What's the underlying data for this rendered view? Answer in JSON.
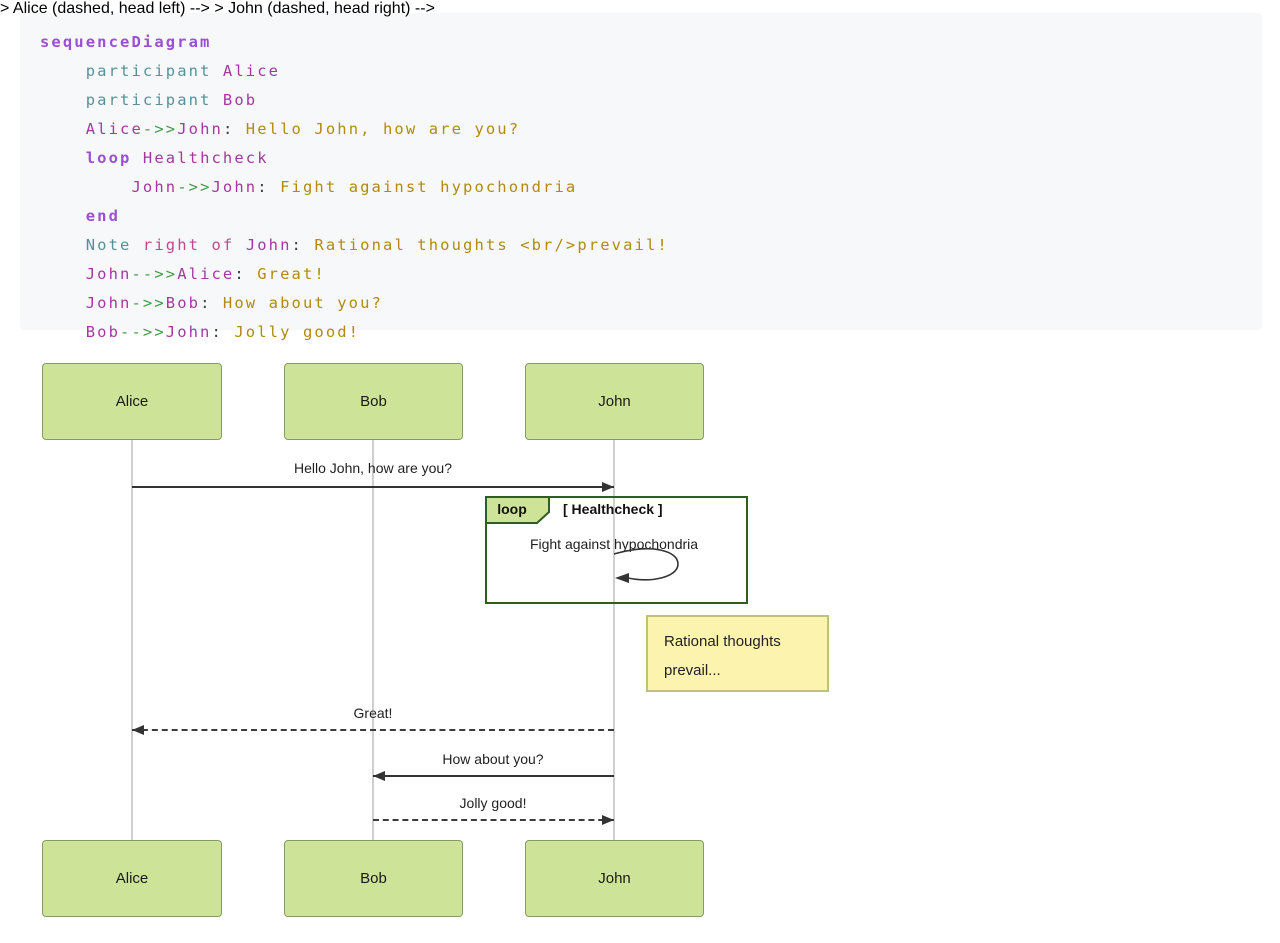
{
  "code": {
    "lines": [
      [
        {
          "t": "sequenceDiagram",
          "c": "kw"
        }
      ],
      [
        {
          "t": "    ",
          "c": "ws"
        },
        {
          "t": "participant",
          "c": "tl"
        },
        {
          "t": " ",
          "c": "ws"
        },
        {
          "t": "Alice",
          "c": "nm"
        }
      ],
      [
        {
          "t": "    ",
          "c": "ws"
        },
        {
          "t": "participant",
          "c": "tl"
        },
        {
          "t": " ",
          "c": "ws"
        },
        {
          "t": "Bob",
          "c": "nm"
        }
      ],
      [
        {
          "t": "    ",
          "c": "ws"
        },
        {
          "t": "Alice",
          "c": "nm"
        },
        {
          "t": "->>",
          "c": "op"
        },
        {
          "t": "John",
          "c": "nm"
        },
        {
          "t": ":",
          "c": "pn"
        },
        {
          "t": " Hello John, how are you?",
          "c": "tx"
        }
      ],
      [
        {
          "t": "    ",
          "c": "ws"
        },
        {
          "t": "loop",
          "c": "kw"
        },
        {
          "t": " ",
          "c": "ws"
        },
        {
          "t": "Healthcheck",
          "c": "nm"
        }
      ],
      [
        {
          "t": "        ",
          "c": "ws"
        },
        {
          "t": "John",
          "c": "nm"
        },
        {
          "t": "->>",
          "c": "op"
        },
        {
          "t": "John",
          "c": "nm"
        },
        {
          "t": ":",
          "c": "pn"
        },
        {
          "t": " Fight against hypochondria",
          "c": "tx"
        }
      ],
      [
        {
          "t": "    ",
          "c": "ws"
        },
        {
          "t": "end",
          "c": "kw"
        }
      ],
      [
        {
          "t": "    ",
          "c": "ws"
        },
        {
          "t": "Note",
          "c": "tl"
        },
        {
          "t": " ",
          "c": "ws"
        },
        {
          "t": "right of",
          "c": "kw2"
        },
        {
          "t": " ",
          "c": "ws"
        },
        {
          "t": "John",
          "c": "nm"
        },
        {
          "t": ":",
          "c": "pn"
        },
        {
          "t": " Rational thoughts <br/>prevail!",
          "c": "tx"
        }
      ],
      [
        {
          "t": "    ",
          "c": "ws"
        },
        {
          "t": "John",
          "c": "nm"
        },
        {
          "t": "-->>",
          "c": "op"
        },
        {
          "t": "Alice",
          "c": "nm"
        },
        {
          "t": ":",
          "c": "pn"
        },
        {
          "t": " Great!",
          "c": "tx"
        }
      ],
      [
        {
          "t": "    ",
          "c": "ws"
        },
        {
          "t": "John",
          "c": "nm"
        },
        {
          "t": "->>",
          "c": "op"
        },
        {
          "t": "Bob",
          "c": "nm"
        },
        {
          "t": ":",
          "c": "pn"
        },
        {
          "t": " How about you?",
          "c": "tx"
        }
      ],
      [
        {
          "t": "    ",
          "c": "ws"
        },
        {
          "t": "Bob",
          "c": "nm"
        },
        {
          "t": "-->>",
          "c": "op"
        },
        {
          "t": "John",
          "c": "nm"
        },
        {
          "t": ":",
          "c": "pn"
        },
        {
          "t": " Jolly good!",
          "c": "tx"
        }
      ]
    ]
  },
  "diagram": {
    "actors": [
      {
        "name": "Alice"
      },
      {
        "name": "Bob"
      },
      {
        "name": "John"
      }
    ],
    "messages": [
      {
        "text": "Hello John, how are you?",
        "from": "Alice",
        "to": "John",
        "style": "solid"
      },
      {
        "text": "Great!",
        "from": "John",
        "to": "Alice",
        "style": "dashed"
      },
      {
        "text": "How about you?",
        "from": "John",
        "to": "Bob",
        "style": "solid"
      },
      {
        "text": "Jolly good!",
        "from": "Bob",
        "to": "John",
        "style": "dashed"
      }
    ],
    "loop": {
      "label": "loop",
      "title": "[ Healthcheck ]",
      "message": "Fight against hypochondria"
    },
    "note": {
      "line1": "Rational thoughts",
      "line2": "prevail..."
    }
  },
  "colors": {
    "code_background": "#f7f8f9",
    "keyword": "#9a4fd4",
    "declaration": "#569199",
    "actor_name_token": "#a538a0",
    "arrow_token": "#3f9b47",
    "message_token": "#b28a0e",
    "actor_fill": "#cde498",
    "actor_border": "#859b66",
    "loop_border": "#2f5e1f",
    "note_fill": "#fcf4ae",
    "note_border": "#bcc47c",
    "arrow_line": "#333333",
    "lifeline": "#cfcfcf"
  }
}
